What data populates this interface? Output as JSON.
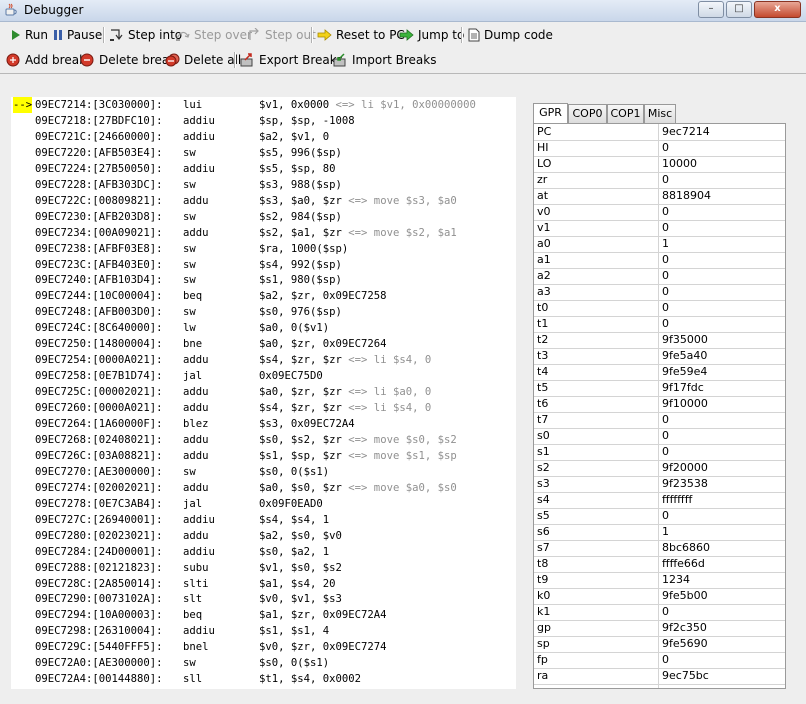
{
  "window": {
    "title": "Debugger",
    "minimize": "–",
    "maximize": "□",
    "close": "x"
  },
  "toolbar1": [
    {
      "label": "Run",
      "icon": "play-icon",
      "enabled": true
    },
    {
      "label": "Pause",
      "icon": "pause-icon",
      "enabled": true
    },
    {
      "label": "Step into",
      "icon": "step-into-icon",
      "enabled": true
    },
    {
      "label": "Step over",
      "icon": "step-over-icon",
      "enabled": false
    },
    {
      "label": "Step out",
      "icon": "step-out-icon",
      "enabled": false
    },
    {
      "label": "Reset to PC",
      "icon": "arrow-right-yellow-icon",
      "enabled": true
    },
    {
      "label": "Jump to",
      "icon": "arrow-right-green-icon",
      "enabled": true
    },
    {
      "label": "Dump code",
      "icon": "document-icon",
      "enabled": true
    }
  ],
  "toolbar2": [
    {
      "label": "Add break",
      "icon": "breakpoint-add-icon"
    },
    {
      "label": "Delete break",
      "icon": "breakpoint-delete-icon"
    },
    {
      "label": "Delete all",
      "icon": "breakpoint-delete-all-icon"
    },
    {
      "label": "Export Breaks",
      "icon": "export-icon"
    },
    {
      "label": "Import Breaks",
      "icon": "import-icon"
    }
  ],
  "disassembly": {
    "current_marker": "-->",
    "rows": [
      {
        "addr": "09EC7214:[3C030000]:",
        "mnemonic": "lui",
        "operands": "$v1, 0x0000",
        "comment": " <=> li $v1, 0x00000000"
      },
      {
        "addr": "09EC7218:[27BDFC10]:",
        "mnemonic": "addiu",
        "operands": "$sp, $sp, -1008",
        "comment": ""
      },
      {
        "addr": "09EC721C:[24660000]:",
        "mnemonic": "addiu",
        "operands": "$a2, $v1, 0",
        "comment": ""
      },
      {
        "addr": "09EC7220:[AFB503E4]:",
        "mnemonic": "sw",
        "operands": "$s5, 996($sp)",
        "comment": ""
      },
      {
        "addr": "09EC7224:[27B50050]:",
        "mnemonic": "addiu",
        "operands": "$s5, $sp, 80",
        "comment": ""
      },
      {
        "addr": "09EC7228:[AFB303DC]:",
        "mnemonic": "sw",
        "operands": "$s3, 988($sp)",
        "comment": ""
      },
      {
        "addr": "09EC722C:[00809821]:",
        "mnemonic": "addu",
        "operands": "$s3, $a0, $zr",
        "comment": " <=> move $s3, $a0"
      },
      {
        "addr": "09EC7230:[AFB203D8]:",
        "mnemonic": "sw",
        "operands": "$s2, 984($sp)",
        "comment": ""
      },
      {
        "addr": "09EC7234:[00A09021]:",
        "mnemonic": "addu",
        "operands": "$s2, $a1, $zr",
        "comment": " <=> move $s2, $a1"
      },
      {
        "addr": "09EC7238:[AFBF03E8]:",
        "mnemonic": "sw",
        "operands": "$ra, 1000($sp)",
        "comment": ""
      },
      {
        "addr": "09EC723C:[AFB403E0]:",
        "mnemonic": "sw",
        "operands": "$s4, 992($sp)",
        "comment": ""
      },
      {
        "addr": "09EC7240:[AFB103D4]:",
        "mnemonic": "sw",
        "operands": "$s1, 980($sp)",
        "comment": ""
      },
      {
        "addr": "09EC7244:[10C00004]:",
        "mnemonic": "beq",
        "operands": "$a2, $zr, 0x09EC7258",
        "comment": ""
      },
      {
        "addr": "09EC7248:[AFB003D0]:",
        "mnemonic": "sw",
        "operands": "$s0, 976($sp)",
        "comment": ""
      },
      {
        "addr": "09EC724C:[8C640000]:",
        "mnemonic": "lw",
        "operands": "$a0, 0($v1)",
        "comment": ""
      },
      {
        "addr": "09EC7250:[14800004]:",
        "mnemonic": "bne",
        "operands": "$a0, $zr, 0x09EC7264",
        "comment": ""
      },
      {
        "addr": "09EC7254:[0000A021]:",
        "mnemonic": "addu",
        "operands": "$s4, $zr, $zr",
        "comment": " <=> li $s4, 0"
      },
      {
        "addr": "09EC7258:[0E7B1D74]:",
        "mnemonic": "jal",
        "operands": "0x09EC75D0",
        "comment": ""
      },
      {
        "addr": "09EC725C:[00002021]:",
        "mnemonic": "addu",
        "operands": "$a0, $zr, $zr",
        "comment": " <=> li $a0, 0"
      },
      {
        "addr": "09EC7260:[0000A021]:",
        "mnemonic": "addu",
        "operands": "$s4, $zr, $zr",
        "comment": " <=> li $s4, 0"
      },
      {
        "addr": "09EC7264:[1A60000F]:",
        "mnemonic": "blez",
        "operands": "$s3, 0x09EC72A4",
        "comment": ""
      },
      {
        "addr": "09EC7268:[02408021]:",
        "mnemonic": "addu",
        "operands": "$s0, $s2, $zr",
        "comment": " <=> move $s0, $s2"
      },
      {
        "addr": "09EC726C:[03A08821]:",
        "mnemonic": "addu",
        "operands": "$s1, $sp, $zr",
        "comment": " <=> move $s1, $sp"
      },
      {
        "addr": "09EC7270:[AE300000]:",
        "mnemonic": "sw",
        "operands": "$s0, 0($s1)",
        "comment": ""
      },
      {
        "addr": "09EC7274:[02002021]:",
        "mnemonic": "addu",
        "operands": "$a0, $s0, $zr",
        "comment": " <=> move $a0, $s0"
      },
      {
        "addr": "09EC7278:[0E7C3AB4]:",
        "mnemonic": "jal",
        "operands": "0x09F0EAD0",
        "comment": ""
      },
      {
        "addr": "09EC727C:[26940001]:",
        "mnemonic": "addiu",
        "operands": "$s4, $s4, 1",
        "comment": ""
      },
      {
        "addr": "09EC7280:[02023021]:",
        "mnemonic": "addu",
        "operands": "$a2, $s0, $v0",
        "comment": ""
      },
      {
        "addr": "09EC7284:[24D00001]:",
        "mnemonic": "addiu",
        "operands": "$s0, $a2, 1",
        "comment": ""
      },
      {
        "addr": "09EC7288:[02121823]:",
        "mnemonic": "subu",
        "operands": "$v1, $s0, $s2",
        "comment": ""
      },
      {
        "addr": "09EC728C:[2A850014]:",
        "mnemonic": "slti",
        "operands": "$a1, $s4, 20",
        "comment": ""
      },
      {
        "addr": "09EC7290:[0073102A]:",
        "mnemonic": "slt",
        "operands": "$v0, $v1, $s3",
        "comment": ""
      },
      {
        "addr": "09EC7294:[10A00003]:",
        "mnemonic": "beq",
        "operands": "$a1, $zr, 0x09EC72A4",
        "comment": ""
      },
      {
        "addr": "09EC7298:[26310004]:",
        "mnemonic": "addiu",
        "operands": "$s1, $s1, 4",
        "comment": ""
      },
      {
        "addr": "09EC729C:[5440FFF5]:",
        "mnemonic": "bnel",
        "operands": "$v0, $zr, 0x09EC7274",
        "comment": ""
      },
      {
        "addr": "09EC72A0:[AE300000]:",
        "mnemonic": "sw",
        "operands": "$s0, 0($s1)",
        "comment": ""
      },
      {
        "addr": "09EC72A4:[00144880]:",
        "mnemonic": "sll",
        "operands": "$t1, $s4, 0x0002",
        "comment": ""
      }
    ]
  },
  "register_tabs": [
    {
      "label": "GPR",
      "active": true
    },
    {
      "label": "COP0",
      "active": false
    },
    {
      "label": "COP1",
      "active": false
    },
    {
      "label": "Misc",
      "active": false
    }
  ],
  "registers": [
    {
      "name": "PC",
      "value": "9ec7214"
    },
    {
      "name": "HI",
      "value": "0"
    },
    {
      "name": "LO",
      "value": "10000"
    },
    {
      "name": "zr",
      "value": "0"
    },
    {
      "name": "at",
      "value": "8818904"
    },
    {
      "name": "v0",
      "value": "0"
    },
    {
      "name": "v1",
      "value": "0"
    },
    {
      "name": "a0",
      "value": "1"
    },
    {
      "name": "a1",
      "value": "0"
    },
    {
      "name": "a2",
      "value": "0"
    },
    {
      "name": "a3",
      "value": "0"
    },
    {
      "name": "t0",
      "value": "0"
    },
    {
      "name": "t1",
      "value": "0"
    },
    {
      "name": "t2",
      "value": "9f35000"
    },
    {
      "name": "t3",
      "value": "9fe5a40"
    },
    {
      "name": "t4",
      "value": "9fe59e4"
    },
    {
      "name": "t5",
      "value": "9f17fdc"
    },
    {
      "name": "t6",
      "value": "9f10000"
    },
    {
      "name": "t7",
      "value": "0"
    },
    {
      "name": "s0",
      "value": "0"
    },
    {
      "name": "s1",
      "value": "0"
    },
    {
      "name": "s2",
      "value": "9f20000"
    },
    {
      "name": "s3",
      "value": "9f23538"
    },
    {
      "name": "s4",
      "value": "ffffffff"
    },
    {
      "name": "s5",
      "value": "0"
    },
    {
      "name": "s6",
      "value": "1"
    },
    {
      "name": "s7",
      "value": "8bc6860"
    },
    {
      "name": "t8",
      "value": "ffffe66d"
    },
    {
      "name": "t9",
      "value": "1234"
    },
    {
      "name": "k0",
      "value": "9fe5b00"
    },
    {
      "name": "k1",
      "value": "0"
    },
    {
      "name": "gp",
      "value": "9f2c350"
    },
    {
      "name": "sp",
      "value": "9fe5690"
    },
    {
      "name": "fp",
      "value": "0"
    },
    {
      "name": "ra",
      "value": "9ec75bc"
    }
  ]
}
